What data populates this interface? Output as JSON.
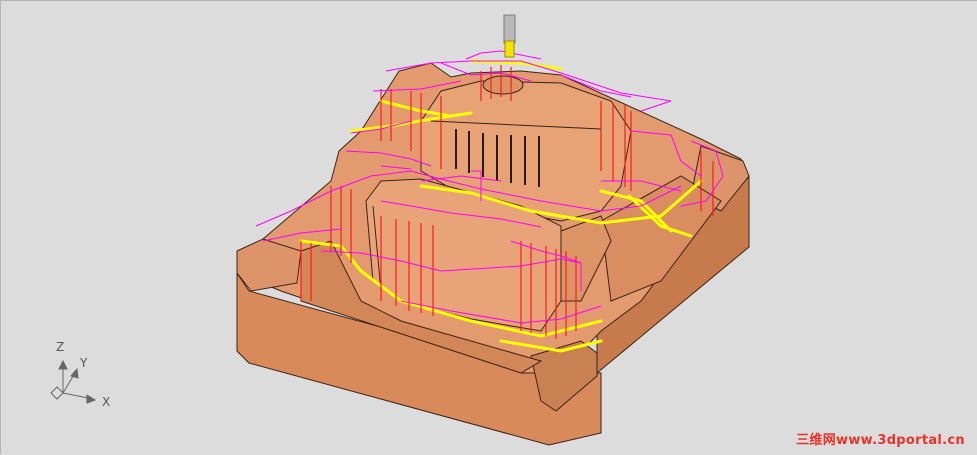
{
  "viewport": {
    "background": "#dcdcdc"
  },
  "axes": {
    "z_label": "Z",
    "y_label": "Y",
    "x_label": "X"
  },
  "model": {
    "body_color": "#e39a6e",
    "shadow_color": "#b86b40",
    "toolpath_colors": [
      "#ff00ff",
      "#ff0000",
      "#ffff00"
    ]
  },
  "tool": {
    "shank_color": "#b9b9b9",
    "tip_color": "#f4e300"
  },
  "watermark": {
    "text": "三维网www.3dportal.cn"
  }
}
